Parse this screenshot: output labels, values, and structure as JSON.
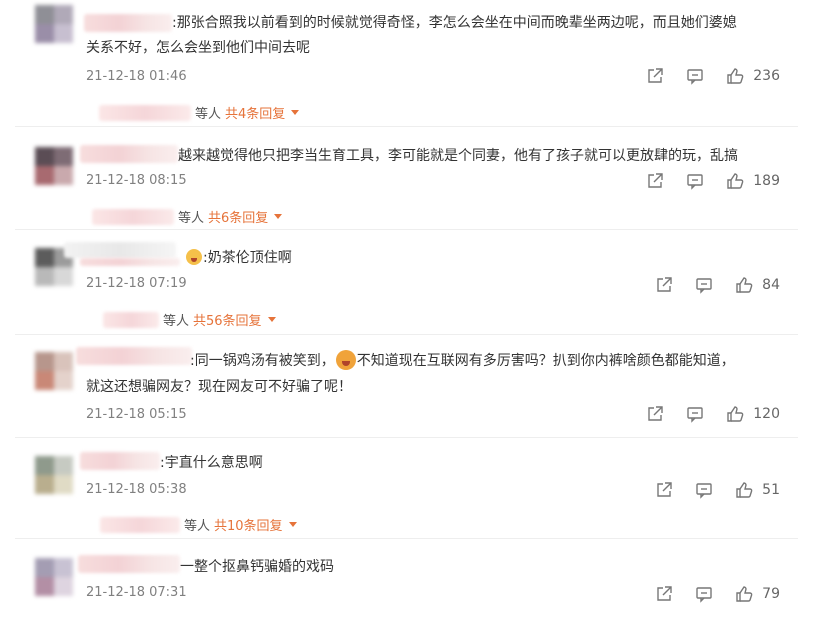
{
  "labels": {
    "suffix": "等人"
  },
  "comments": [
    {
      "line1": ":那张合照我以前看到的时候就觉得奇怪，李怎么会坐在中间而晚辈坐两边呢，而且她们婆媳",
      "line2": "关系不好，怎么会坐到他们中间去呢",
      "time": "21-12-18 01:46",
      "likes": "236",
      "replies": "共4条回复"
    },
    {
      "line1": "越来越觉得他只把李当生育工具，李可能就是个同妻，他有了孩子就可以更放肆的玩，乱搞",
      "time": "21-12-18 08:15",
      "likes": "189",
      "replies": "共6条回复"
    },
    {
      "line1": ":奶茶伦顶住啊",
      "time": "21-12-18 07:19",
      "likes": "84",
      "replies": "共56条回复"
    },
    {
      "line1a": ":同一锅鸡汤有被笑到，",
      "line1b": "不知道现在互联网有多厉害吗？扒到你内裤啥颜色都能知道，",
      "line2": "就这还想骗网友？现在网友可不好骗了呢！",
      "time": "21-12-18 05:15",
      "likes": "120"
    },
    {
      "line1": ":宇直什么意思啊",
      "time": "21-12-18 05:38",
      "likes": "51",
      "replies": "共10条回复"
    },
    {
      "line1": "一整个抠鼻钙骗婚的戏码",
      "time": "21-12-18 07:31",
      "likes": "79"
    }
  ],
  "icons": [
    "share-icon",
    "reply-icon",
    "thumbs-up-icon",
    "emoji-icon"
  ],
  "colors": {
    "reply_link": "#e6733a",
    "timestamp": "#808080",
    "text": "#333333"
  }
}
